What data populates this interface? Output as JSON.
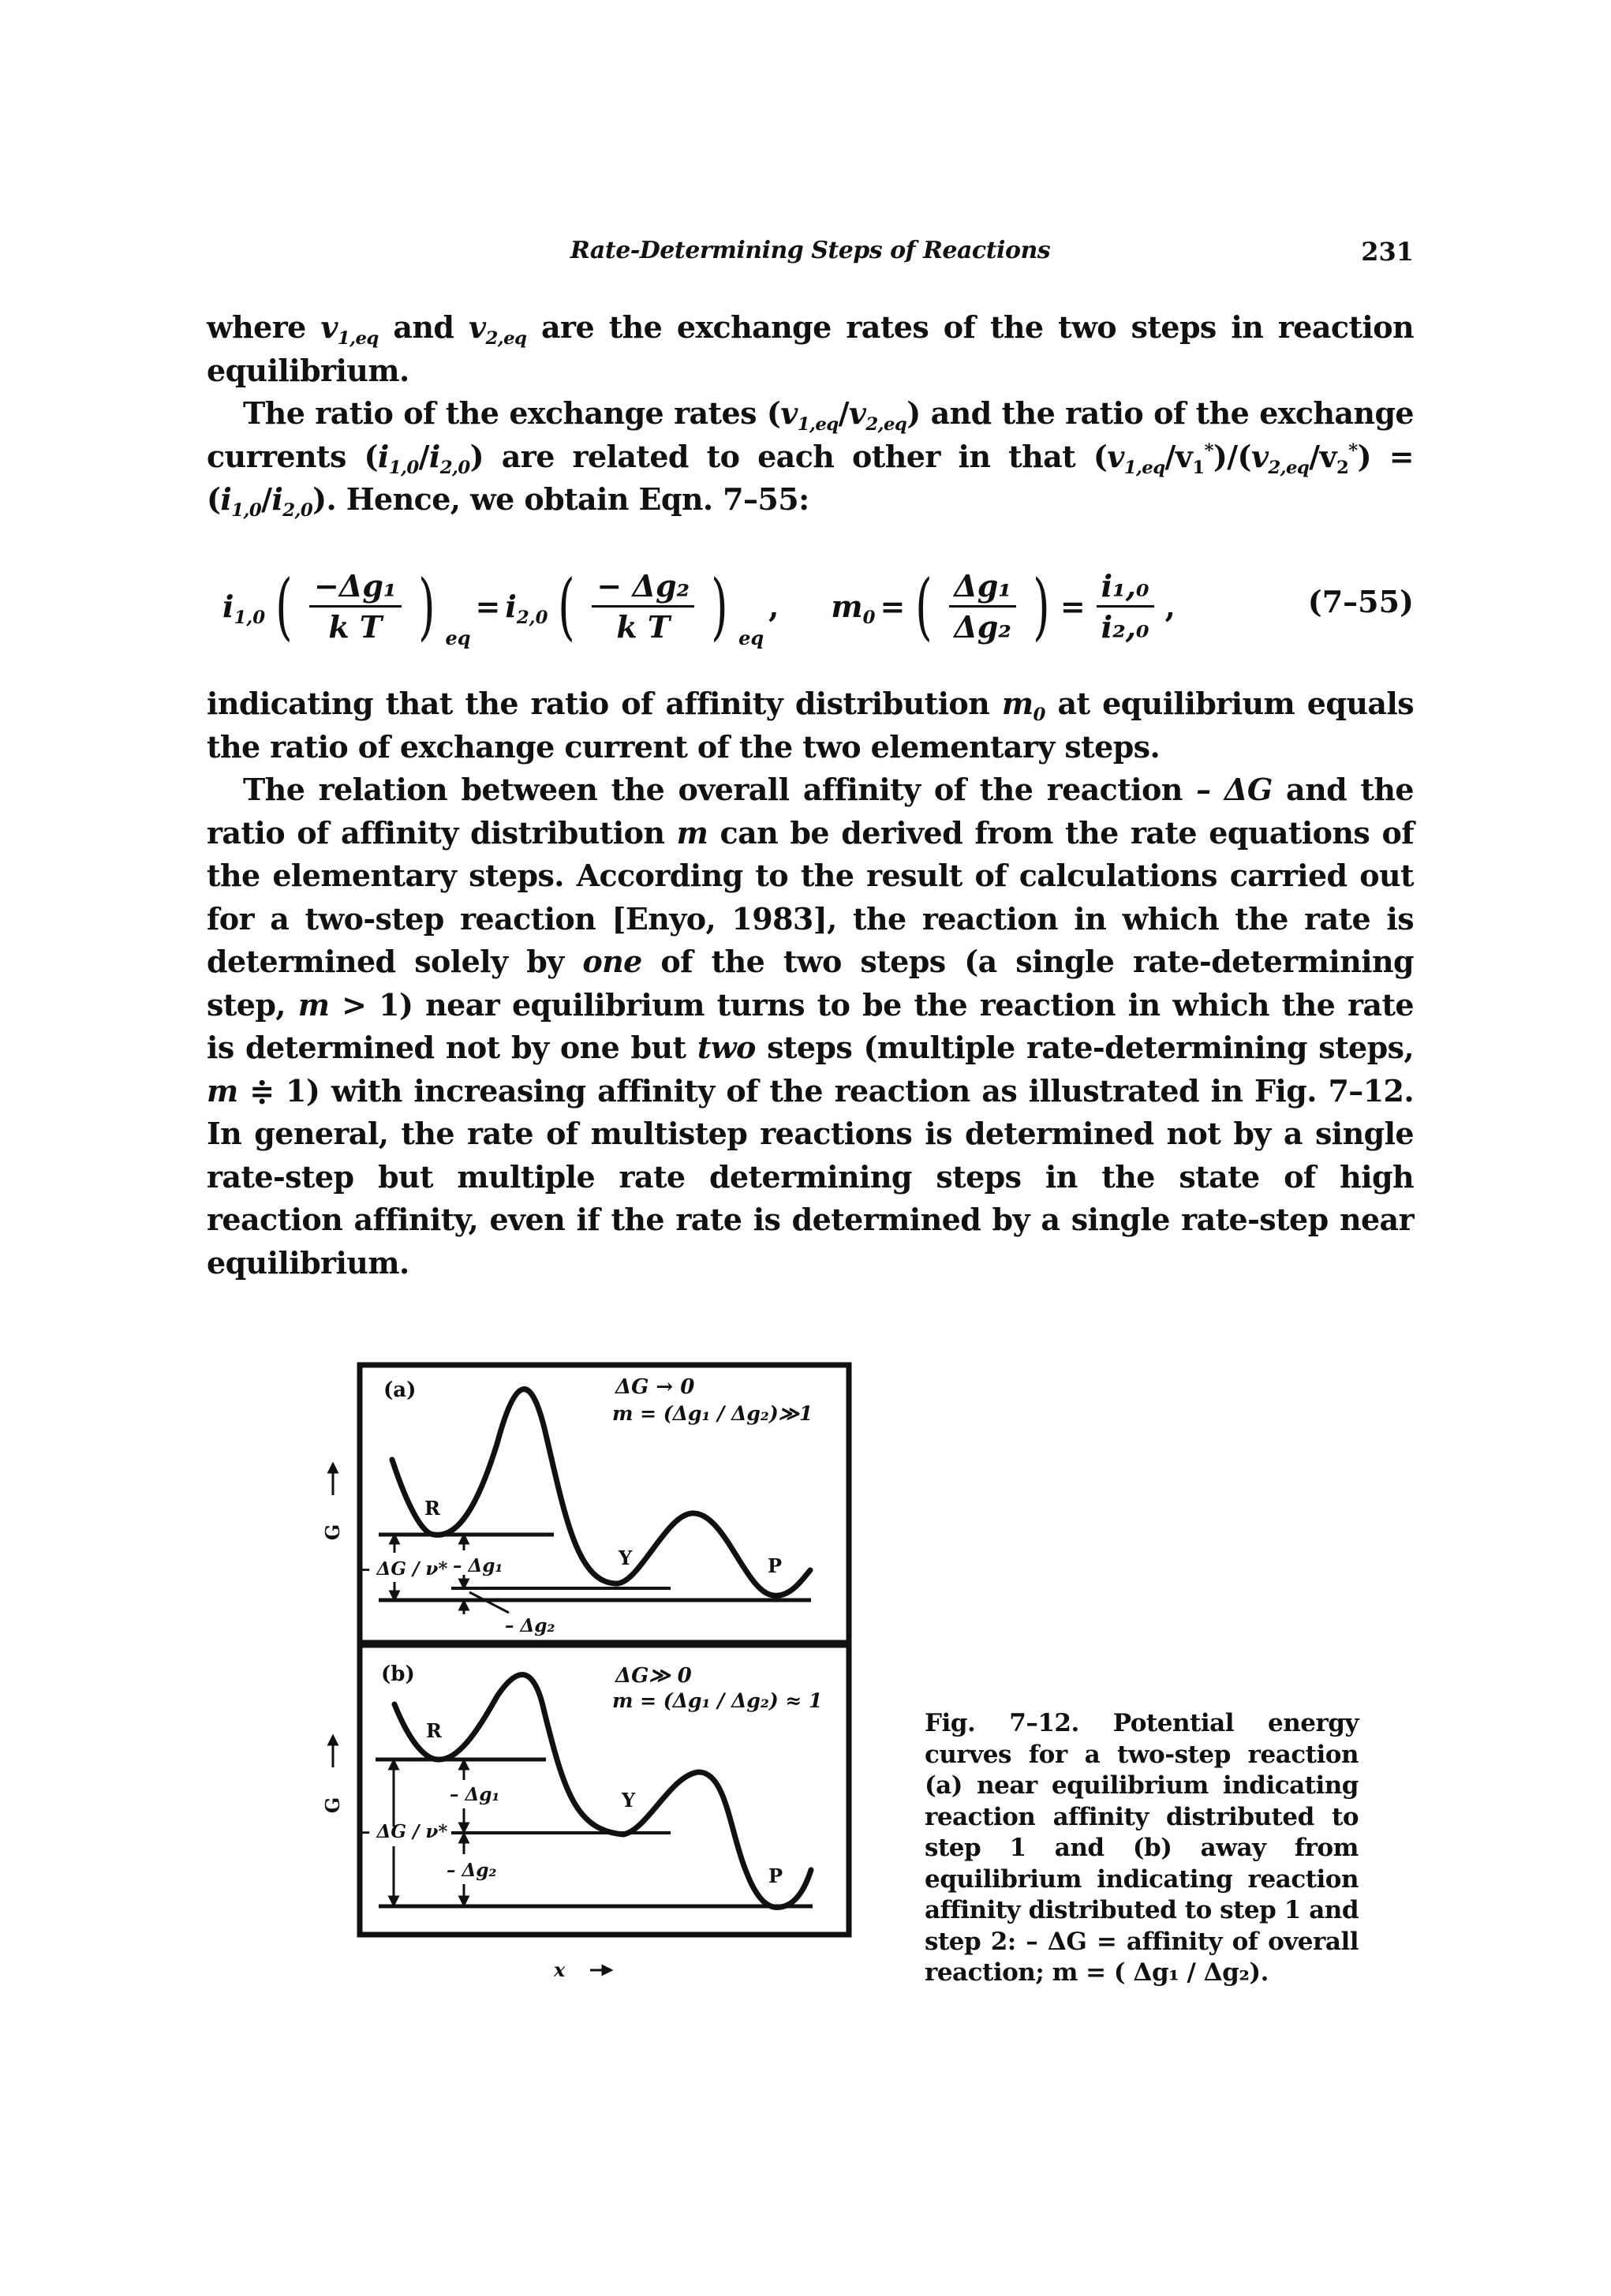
{
  "header": {
    "running_title": "Rate-Determining Steps of Reactions",
    "page_number": "231"
  },
  "paragraphs": {
    "p1": {
      "t1": "where ",
      "m1": "v",
      "m1_sub": "1,eq",
      "t2": " and ",
      "m2": "v",
      "m2_sub": "2,eq",
      "t3": " are the exchange rates of the two steps in reaction equilibrium."
    },
    "p2": {
      "t1": "The ratio of the exchange rates (",
      "m1": "v",
      "m1_sub": "1,eq",
      "t_slash1": "/",
      "m2": "v",
      "m2_sub": "2,eq",
      "t2": ") and the ratio of the exchange currents (",
      "m3": "i",
      "m3_sub": "1,0",
      "t_slash2": "/",
      "m4": "i",
      "m4_sub": "2,0",
      "t3": ") are related to each other in that (",
      "m5": "v",
      "m5_sub": "1,eq",
      "t4": "/v",
      "m6_sub": "1",
      "m6_sup": "*",
      "t5": ")/(",
      "m7": "v",
      "m7_sub": "2,eq",
      "t6": "/v",
      "m8_sub": "2",
      "m8_sup": "*",
      "t7": ") = (",
      "m9": "i",
      "m9_sub": "1,0",
      "t_slash3": "/",
      "m10": "i",
      "m10_sub": "2,0",
      "t8": "). Hence, we obtain Eqn. 7–55:"
    },
    "p3": {
      "t1": "indicating that the ratio of affinity distribution ",
      "m1": "m",
      "m1_sub": "0",
      "t2": " at equilibrium equals the ratio of exchange current of the two elementary steps."
    },
    "p4": {
      "t1": "The relation between the overall affinity of the reaction ",
      "m1": "– ΔG",
      "t2": " and the ratio of affinity distribution ",
      "m2": "m",
      "t3": " can be derived from the rate equations of the elementary steps. According to the result of calculations carried out for a two-step reaction [Enyo, 1983], the reaction in which the rate is determined solely by ",
      "em1": "one",
      "t4": " of the two steps (a single rate-determining step, ",
      "m3": "m",
      "t5": " > 1) near equilibrium turns to be the reaction in which the rate is determined not by one but ",
      "em2": "two",
      "t6": " steps (multiple rate-determining steps, ",
      "m4": "m",
      "t7": " ≑ 1) with increasing affinity of the reaction as illustrated in Fig. 7–12. In general, the rate of multistep reactions is determined not by a single rate-step but multiple rate determining steps in the state of high reaction affinity, even if the rate is determined by a single rate-step near equilibrium."
    }
  },
  "equation": {
    "lhs_i": "i",
    "lhs_i_sub": "1,0",
    "frac1_num": "−Δg₁",
    "frac1_den": "k T",
    "eq_sub": "eq",
    "equals": "=",
    "rhs_i": "i",
    "rhs_i_sub": "2,0",
    "frac2_num": "− Δg₂",
    "frac2_den": "k T",
    "comma": ",",
    "m0": "m",
    "m0_sub": "0",
    "frac3_num": "Δg₁",
    "frac3_den": "Δg₂",
    "frac4_num": "i₁,₀",
    "frac4_den": "i₂,₀",
    "number": "(7–55)"
  },
  "figure": {
    "y_axis_label": "G",
    "x_axis_label": "x",
    "panel_a": {
      "label": "(a)",
      "cond1": "ΔG → 0",
      "cond2": "m = (Δg₁ / Δg₂)≫1",
      "state_R": "R",
      "state_Y": "Y",
      "state_P": "P",
      "label_dG": "– ΔG / ν*",
      "label_dg1": "– Δg₁",
      "label_dg2": "– Δg₂"
    },
    "panel_b": {
      "label": "(b)",
      "cond1": "ΔG≫ 0",
      "cond2": "m = (Δg₁ / Δg₂) ≈ 1",
      "state_R": "R",
      "state_Y": "Y",
      "state_P": "P",
      "label_dG": "– ΔG / ν*",
      "label_dg1": "– Δg₁",
      "label_dg2": "– Δg₂"
    }
  },
  "caption": {
    "label": "Fig. 7–12.",
    "text": " Potential energy curves for a two-step reaction (a) near equilibrium indicating reaction affinity distributed to step 1 and (b) away from equilibrium indicating reaction affinity distributed to step 1 and step 2: – ΔG = affinity of overall reaction; m = ( Δg₁ / Δg₂)."
  }
}
